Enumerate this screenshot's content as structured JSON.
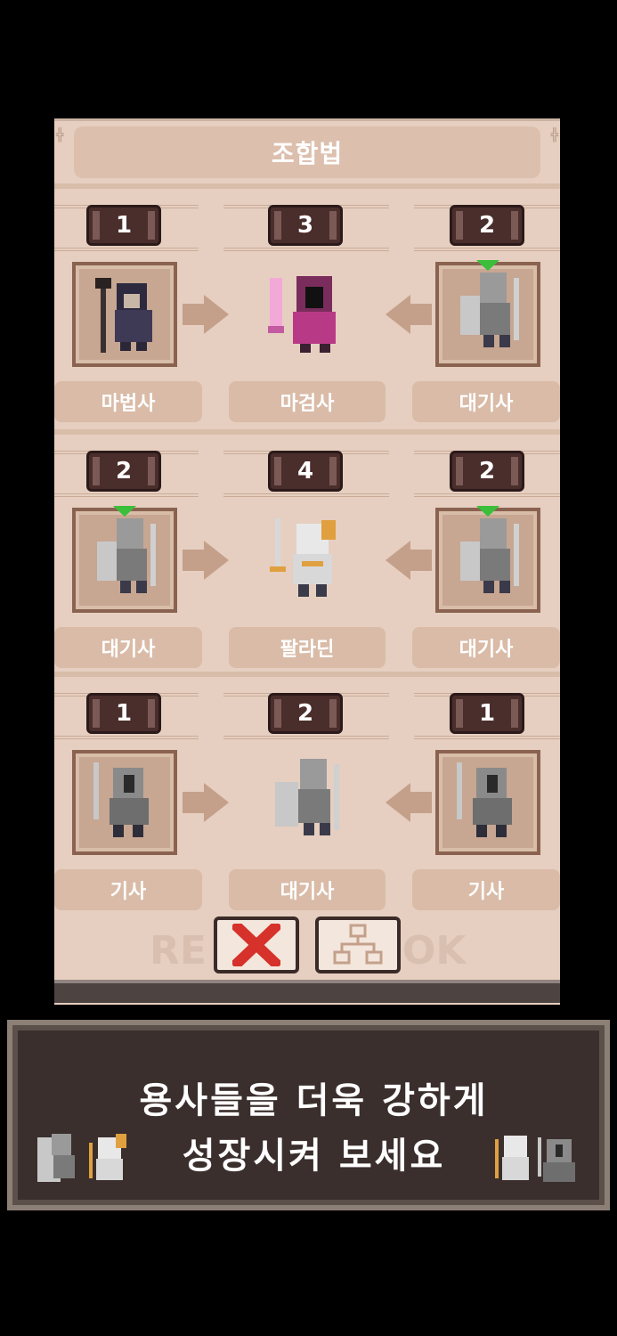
{
  "book": {
    "title": "조합법",
    "watermark_left": "RE",
    "watermark_right": "OK"
  },
  "recipes": [
    {
      "left": {
        "count": "1",
        "name": "마법사"
      },
      "result": {
        "count": "3",
        "name": "마검사"
      },
      "right": {
        "count": "2",
        "name": "대기사"
      }
    },
    {
      "left": {
        "count": "2",
        "name": "대기사"
      },
      "result": {
        "count": "4",
        "name": "팔라딘"
      },
      "right": {
        "count": "2",
        "name": "대기사"
      }
    },
    {
      "left": {
        "count": "1",
        "name": "기사"
      },
      "result": {
        "count": "2",
        "name": "대기사"
      },
      "right": {
        "count": "1",
        "name": "기사"
      }
    }
  ],
  "buttons": {
    "close_icon": "close-icon",
    "tree_icon": "tree-icon"
  },
  "banner": {
    "line1": "용사들을 더욱 강하게",
    "line2": "성장시켜 보세요"
  },
  "colors": {
    "book_bg": "#e6cfc0",
    "badge": "#4a2e2c",
    "banner_bg": "#3a2f2d",
    "close_red": "#d6312a"
  }
}
